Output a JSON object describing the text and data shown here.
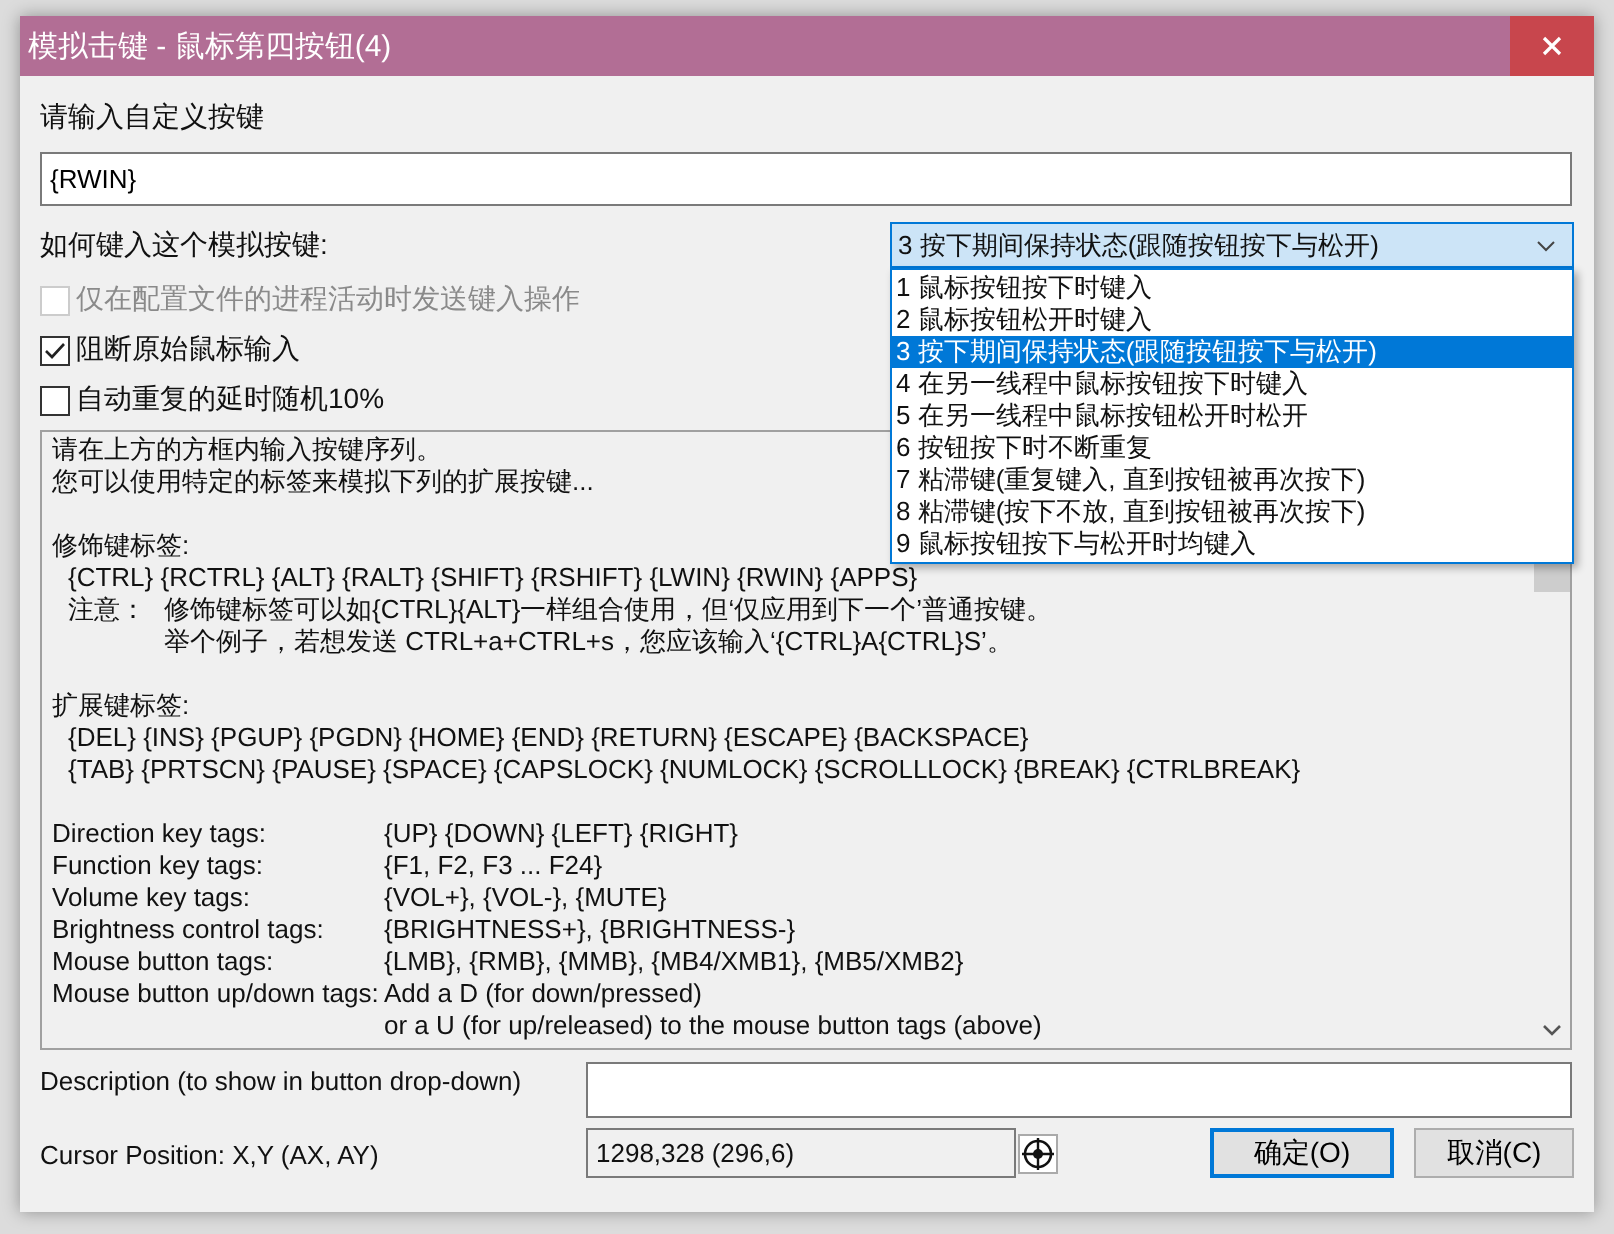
{
  "window": {
    "title": "模拟击键 - 鼠标第四按钮(4)"
  },
  "custom_key": {
    "label": "请输入自定义按键",
    "value": "{RWIN}"
  },
  "input_mode": {
    "label": "如何键入这个模拟按键:",
    "value": "3 按下期间保持状态(跟随按钮按下与松开)",
    "expanded": true,
    "options": [
      {
        "label": "1 鼠标按钮按下时键入",
        "selected": false
      },
      {
        "label": "2 鼠标按钮松开时键入",
        "selected": false
      },
      {
        "label": "3 按下期间保持状态(跟随按钮按下与松开)",
        "selected": true
      },
      {
        "label": "4 在另一线程中鼠标按钮按下时键入",
        "selected": false
      },
      {
        "label": "5 在另一线程中鼠标按钮松开时松开",
        "selected": false
      },
      {
        "label": "6 按钮按下时不断重复",
        "selected": false
      },
      {
        "label": "7 粘滞键(重复键入, 直到按钮被再次按下)",
        "selected": false
      },
      {
        "label": "8 粘滞键(按下不放, 直到按钮被再次按下)",
        "selected": false
      },
      {
        "label": "9 鼠标按钮按下与松开时均键入",
        "selected": false
      }
    ]
  },
  "options": [
    {
      "label": "仅在配置文件的进程活动时发送键入操作",
      "checked": false,
      "disabled": true
    },
    {
      "label": "阻断原始鼠标输入",
      "checked": true,
      "disabled": false
    },
    {
      "label": "自动重复的延时随机10%",
      "checked": false,
      "disabled": false
    }
  ],
  "help_text": [
    [
      {
        "kind": "text",
        "text": "请在上方的方框内输入按键序列。"
      },
      {
        "kind": "text",
        "text": "您可以使用特定的标签来模拟下列的扩展按键..."
      }
    ],
    [
      {
        "kind": "text",
        "text": "修饰键标签:"
      },
      {
        "kind": "item",
        "text": "{CTRL} {RCTRL} {ALT} {RALT} {SHIFT} {RSHIFT} {LWIN} {RWIN} {APPS}"
      },
      {
        "kind": "note",
        "label": "注意：",
        "text": "修饰键标签可以如{CTRL}{ALT}一样组合使用，但‘仅应用到下一个’普通按键。"
      },
      {
        "kind": "note",
        "text": "举个例子，若想发送 CTRL+a+CTRL+s，您应该输入‘{CTRL}A{CTRL}S’。"
      }
    ],
    [
      {
        "kind": "text",
        "text": "扩展键标签:"
      },
      {
        "kind": "item",
        "text": "{DEL} {INS} {PGUP} {PGDN} {HOME} {END} {RETURN} {ESCAPE} {BACKSPACE}"
      },
      {
        "kind": "item",
        "text": "{TAB} {PRTSCN} {PAUSE} {SPACE} {CAPSLOCK} {NUMLOCK} {SCROLLLOCK} {BREAK} {CTRLBREAK}"
      }
    ],
    [
      {
        "kind": "tag",
        "label": "Direction key tags:",
        "text": "{UP} {DOWN} {LEFT} {RIGHT}"
      },
      {
        "kind": "tag",
        "label": "Function key tags:",
        "text": "{F1, F2, F3 ... F24}"
      },
      {
        "kind": "tag",
        "label": "Volume key tags:",
        "text": "{VOL+}, {VOL-}, {MUTE}"
      },
      {
        "kind": "tag",
        "label": "Brightness control tags:",
        "text": "{BRIGHTNESS+}, {BRIGHTNESS-}"
      },
      {
        "kind": "tag",
        "label": "Mouse button tags:",
        "text": "{LMB}, {RMB}, {MMB}, {MB4/XMB1}, {MB5/XMB2}"
      },
      {
        "kind": "tag",
        "label": "Mouse button up/down tags:",
        "text": "Add a D (for down/pressed)"
      },
      {
        "kind": "tag",
        "text": "or a U (for up/released) to the mouse button tags (above)"
      }
    ]
  ],
  "description": {
    "label": "Description (to show in button drop-down)"
  },
  "cursor_position": {
    "label": "Cursor Position: X,Y (AX, AY)",
    "value": "1298,328 (296,6)"
  },
  "buttons": [
    {
      "label": "确定(O)",
      "kind": "default"
    },
    {
      "label": "取消(C)",
      "kind": "normal"
    }
  ]
}
